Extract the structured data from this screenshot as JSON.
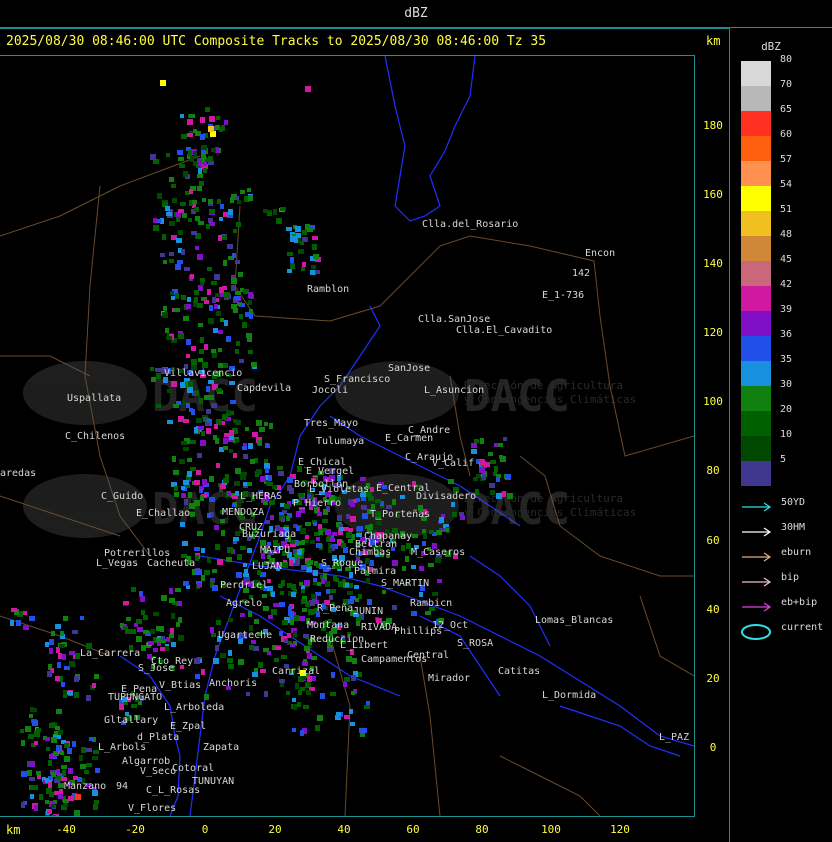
{
  "window": {
    "title": "dBZ"
  },
  "header": {
    "text": "2025/08/30 08:46:00 UTC Composite Tracks to 2025/08/30 08:46:00 Tz 35",
    "km_top": "km",
    "km_bottom": "km"
  },
  "scale": {
    "title": "dBZ",
    "levels": [
      {
        "value": "80",
        "color": "#d8d8d8"
      },
      {
        "value": "70",
        "color": "#b8b8b8"
      },
      {
        "value": "65",
        "color": "#ff3020"
      },
      {
        "value": "60",
        "color": "#ff6010"
      },
      {
        "value": "57",
        "color": "#ff9050"
      },
      {
        "value": "54",
        "color": "#ffff00"
      },
      {
        "value": "51",
        "color": "#f0c020"
      },
      {
        "value": "48",
        "color": "#d08838"
      },
      {
        "value": "45",
        "color": "#c86878"
      },
      {
        "value": "42",
        "color": "#d018a0"
      },
      {
        "value": "39",
        "color": "#8010c8"
      },
      {
        "value": "36",
        "color": "#2050e8"
      },
      {
        "value": "35",
        "color": "#1890e0"
      },
      {
        "value": "30",
        "color": "#108010"
      },
      {
        "value": "20",
        "color": "#006000"
      },
      {
        "value": "10",
        "color": "#004800"
      },
      {
        "value": "5",
        "color": "#403890"
      }
    ]
  },
  "tracks_legend": [
    {
      "label": "50YD",
      "color": "#30e0e0"
    },
    {
      "label": "30HM",
      "color": "#ffffff"
    },
    {
      "label": "eburn",
      "color": "#e0b080"
    },
    {
      "label": "bip",
      "color": "#f0c0d0"
    },
    {
      "label": "eb+bip",
      "color": "#e040e0"
    },
    {
      "label": "current",
      "color": "#30e0e0"
    }
  ],
  "axes": {
    "x_ticks": [
      "-40",
      "-20",
      "0",
      "20",
      "40",
      "60",
      "80",
      "100",
      "120"
    ],
    "y_ticks": [
      "180",
      "160",
      "140",
      "120",
      "100",
      "80",
      "60",
      "40",
      "20",
      "0"
    ]
  },
  "watermark": {
    "brand": "DACC",
    "line1": "Dirección de Agricultura",
    "line2": "y Contingencias Climáticas"
  },
  "places": [
    "Clla.del_Rosario",
    "Encon",
    "142",
    "E_1-736",
    "Ramblon",
    "Clla.SanJose",
    "Clla.El_Cavadito",
    "Villavicencio",
    "Capdevila",
    "S_Francisco",
    "SanJose",
    "L_Asuncion",
    "Uspallata",
    "Jocoli",
    "Tres_Mayo",
    "C_Andre",
    "Tulumaya",
    "E_Carmen",
    "C_Chilenos",
    "E_Chical",
    "C_Araujo",
    "V_Calif",
    "E_Vergel",
    "aredas",
    "Borbollon",
    "E_Central",
    "Divisadero",
    "C_Guido",
    "L_HERAS",
    "L_Violetas",
    "E_Challao",
    "P_Hierro",
    "T_Porteñas",
    "MENDOZA",
    "CRUZ",
    "Chapanay",
    "Buzuriaga",
    "Beltran",
    "MAIPU",
    "Chimbas",
    "M_Caseros",
    "Potrerillos",
    "Cacheuta",
    "L_Vegas",
    "LUJAN",
    "S_Roque",
    "Palmira",
    "Perdriel",
    "S_MARTIN",
    "Agrelo",
    "R_Peña",
    "JUNIN",
    "Rambicn",
    "Montana",
    "Lomas_Blancas",
    "RIVADA",
    "12_Oct",
    "Ugarteche",
    "Reduccion",
    "Phillips",
    "S_ROSA",
    "La_Carrera",
    "Cto_Rey",
    "L_Libert",
    "Central",
    "S_Jose",
    "Carrizal",
    "Campamentos",
    "Catitas",
    "Anchoris",
    "Mirador",
    "V_Btias",
    "E_Pena",
    "TUPUNGATO",
    "L_Dormida",
    "L_Arboleda",
    "Gltallary",
    "E_Zpal",
    "d_Plata",
    "L_PAZ",
    "L_Arbols",
    "Zapata",
    "Algarrob",
    "V_Seco",
    "Cotoral",
    "TUNUYAN",
    "Manzano",
    "94",
    "C_L_Rosas",
    "V_Flores"
  ]
}
